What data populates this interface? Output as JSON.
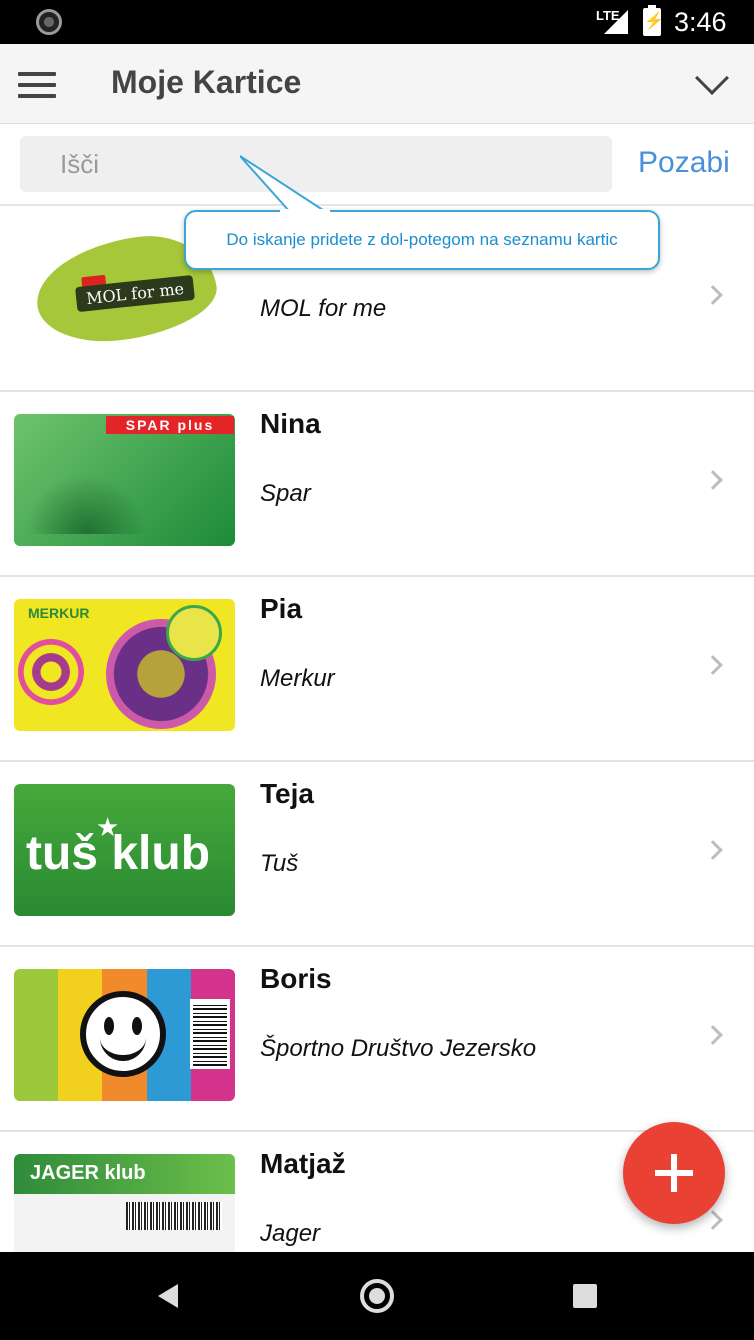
{
  "status_bar": {
    "time": "3:46",
    "network": "LTE"
  },
  "header": {
    "title": "Moje Kartice"
  },
  "search": {
    "placeholder": "Išči",
    "cancel_label": "Pozabi"
  },
  "tooltip": {
    "text": "Do iskanje pridete z dol-potegom na seznamu kartic"
  },
  "cards": [
    {
      "owner": "",
      "store": "MOL for me",
      "card_text": "MOL for me"
    },
    {
      "owner": "Nina",
      "store": "Spar",
      "card_text": "SPAR plus"
    },
    {
      "owner": "Pia",
      "store": "Merkur",
      "card_text": "MERKUR"
    },
    {
      "owner": "Teja",
      "store": "Tuš",
      "card_text": "tuš klub"
    },
    {
      "owner": "Boris",
      "store": "Športno Društvo Jezersko",
      "card_text": ""
    },
    {
      "owner": "Matjaž",
      "store": "Jager",
      "card_text": "JAGER klub"
    }
  ],
  "colors": {
    "accent": "#4a90d9",
    "fab": "#e94235",
    "tooltip_border": "#3aa6d6"
  }
}
